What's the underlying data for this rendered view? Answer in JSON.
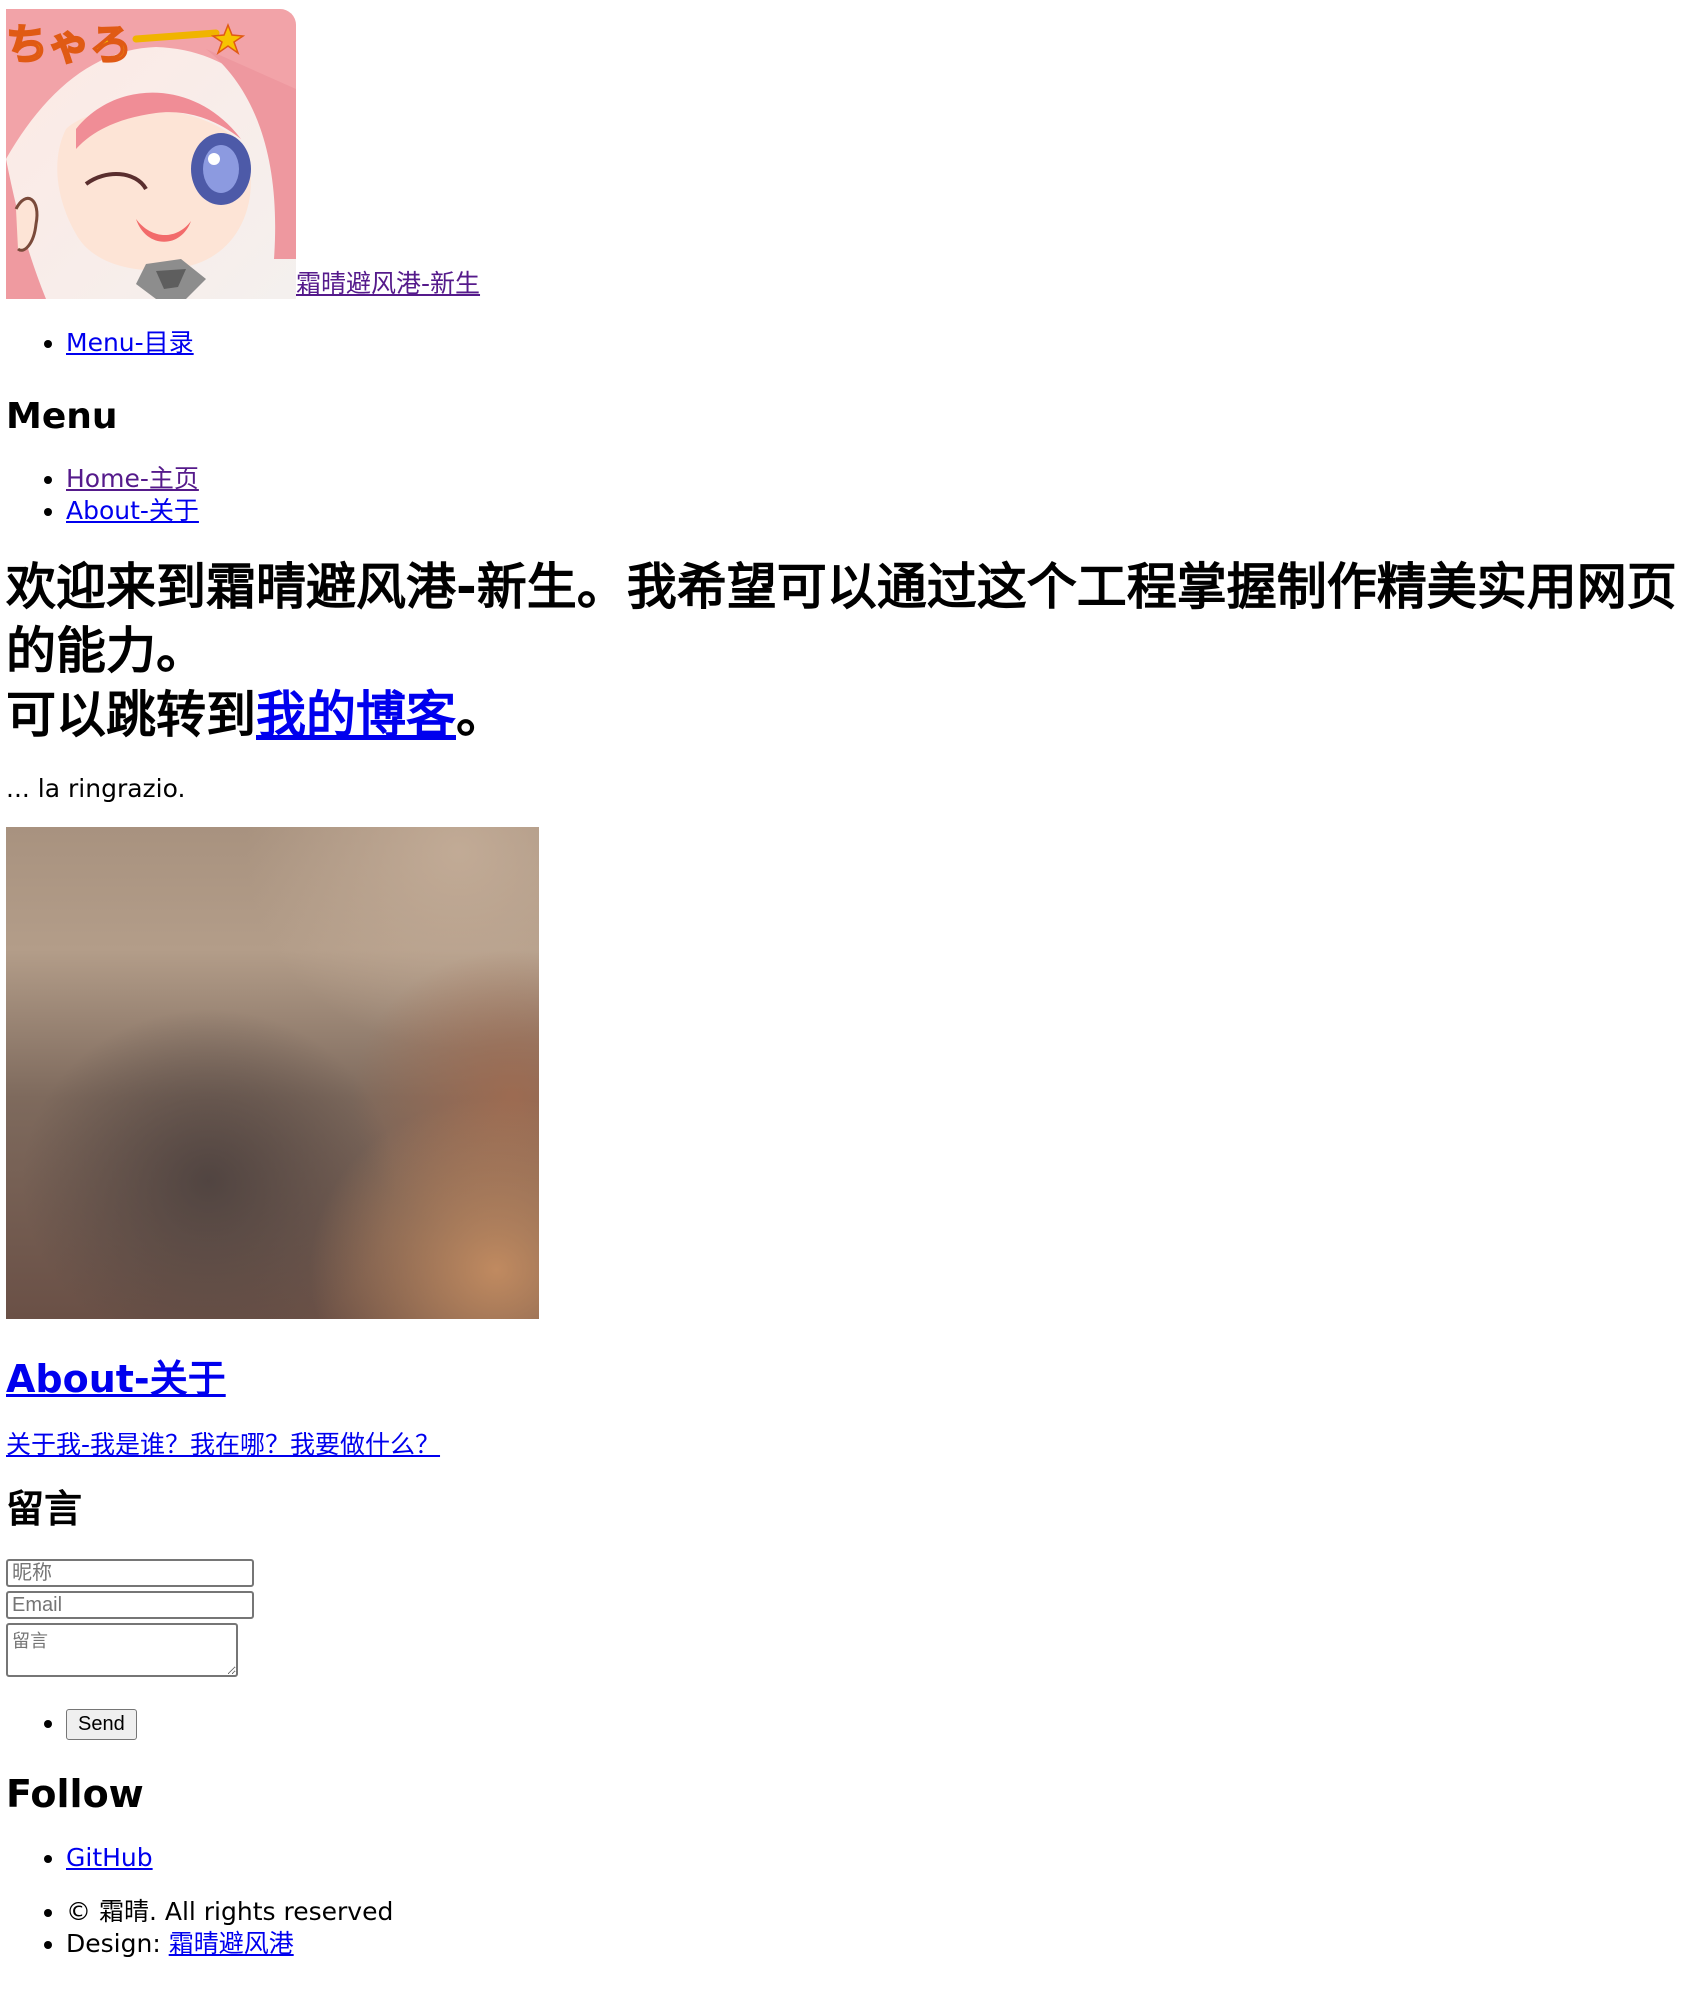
{
  "header": {
    "site_title": "霜晴避风港-新生"
  },
  "nav": {
    "menu_toggle_label": "Menu-目录"
  },
  "menu": {
    "title": "Menu",
    "items": [
      {
        "label": "Home-主页"
      },
      {
        "label": "About-关于"
      }
    ]
  },
  "hero": {
    "line1": "欢迎来到霜晴避风港-新生。我希望可以通过这个工程掌握制作精美实用网页的能力。",
    "line2_prefix": "可以跳转到",
    "blog_link": "我的博客",
    "line2_suffix": "。",
    "tagline": "... la ringrazio."
  },
  "about": {
    "title": "About-关于",
    "description": "关于我-我是谁？我在哪？我要做什么？"
  },
  "comment": {
    "title": "留言",
    "nickname_placeholder": "昵称",
    "email_placeholder": "Email",
    "message_placeholder": "留言",
    "send_label": "Send"
  },
  "follow": {
    "title": "Follow",
    "items": [
      {
        "label": "GitHub"
      }
    ]
  },
  "footer": {
    "copyright": "© 霜晴. All rights reserved",
    "design_label": "Design: ",
    "design_link": "霜晴避风港"
  }
}
